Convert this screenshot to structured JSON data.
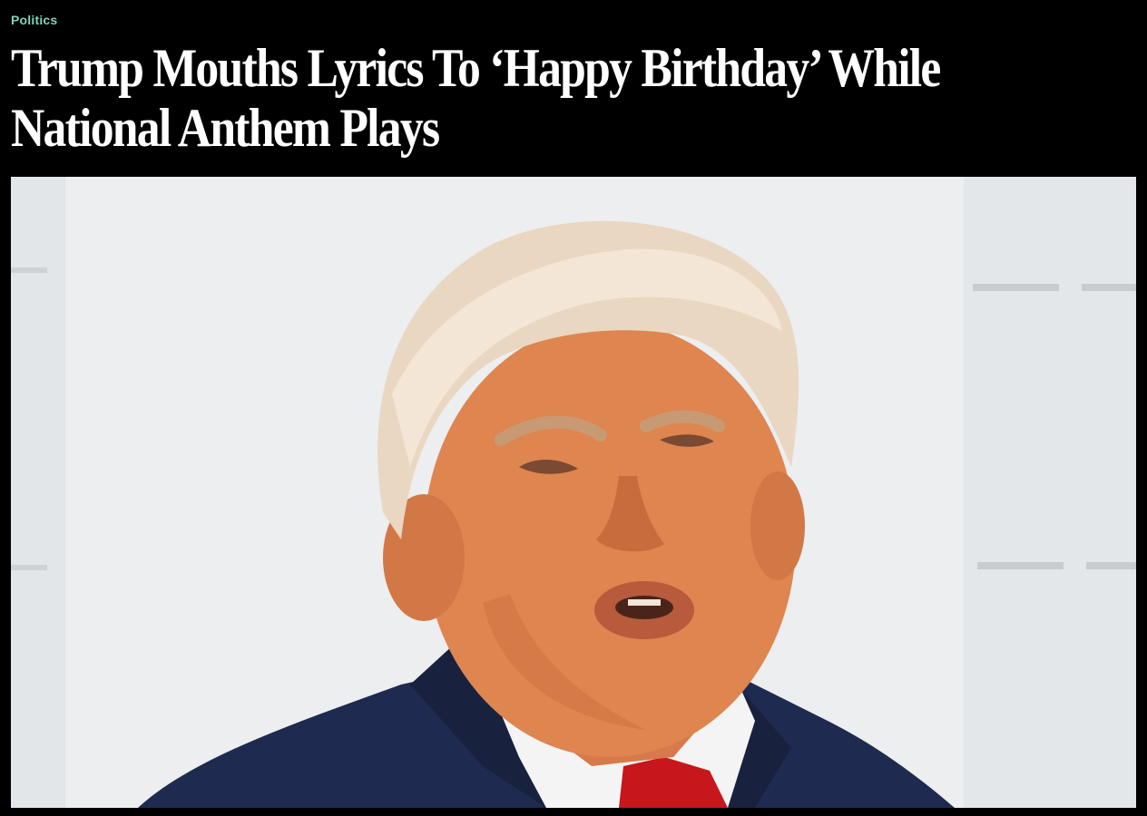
{
  "article": {
    "section_label": "Politics",
    "headline": "Trump Mouths Lyrics To ‘Happy Birthday’ While National Anthem Plays"
  },
  "colors": {
    "background": "#000000",
    "section_label": "#7fd4b8",
    "headline_text": "#ffffff",
    "photo_backdrop": "#e9ebec",
    "suit": "#1e2a4f",
    "tie": "#c8161d"
  }
}
